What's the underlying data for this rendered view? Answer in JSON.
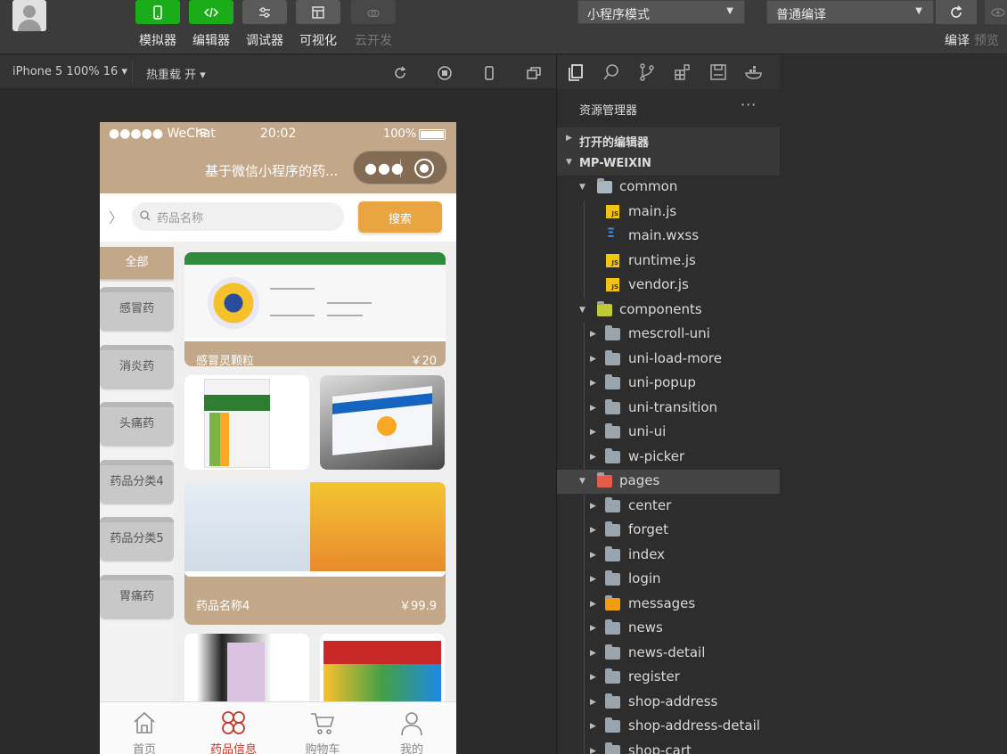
{
  "toolbar": {
    "buttons": [
      {
        "label": "模拟器"
      },
      {
        "label": "编辑器"
      },
      {
        "label": "调试器"
      },
      {
        "label": "可视化"
      },
      {
        "label": "云开发"
      }
    ],
    "mode_select": "小程序模式",
    "compile_select": "普通编译",
    "compile_label": "编译",
    "preview_label": "预览"
  },
  "simbar": {
    "device": "iPhone 5 100% 16 ▾",
    "hot_reload": "热重载 开 ▾"
  },
  "phone": {
    "carrier": "●●●●● WeChat",
    "time": "20:02",
    "battery": "100%",
    "nav_title": "基于微信小程序的药...",
    "search_placeholder": "药品名称",
    "search_button": "搜索",
    "categories": [
      "全部",
      "感冒药",
      "消炎药",
      "头痛药",
      "药品分类4",
      "药品分类5",
      "胃痛药"
    ],
    "products": [
      {
        "name": "感冒灵颗粒",
        "price": "￥20"
      },
      {
        "name": "药品名称4",
        "price": "￥99.9"
      }
    ],
    "tabs": [
      {
        "label": "首页"
      },
      {
        "label": "药品信息"
      },
      {
        "label": "购物车"
      },
      {
        "label": "我的"
      }
    ]
  },
  "explorer": {
    "title": "资源管理器",
    "open_editors": "打开的编辑器",
    "project": "MP-WEIXIN",
    "tree": [
      {
        "label": "common"
      },
      {
        "label": "main.js"
      },
      {
        "label": "main.wxss"
      },
      {
        "label": "runtime.js"
      },
      {
        "label": "vendor.js"
      },
      {
        "label": "components"
      },
      {
        "label": "mescroll-uni"
      },
      {
        "label": "uni-load-more"
      },
      {
        "label": "uni-popup"
      },
      {
        "label": "uni-transition"
      },
      {
        "label": "uni-ui"
      },
      {
        "label": "w-picker"
      },
      {
        "label": "pages"
      },
      {
        "label": "center"
      },
      {
        "label": "forget"
      },
      {
        "label": "index"
      },
      {
        "label": "login"
      },
      {
        "label": "messages"
      },
      {
        "label": "news"
      },
      {
        "label": "news-detail"
      },
      {
        "label": "register"
      },
      {
        "label": "shop-address"
      },
      {
        "label": "shop-address-detail"
      },
      {
        "label": "shop-cart"
      }
    ]
  },
  "colors": {
    "accent_green": "#1aad19",
    "nav_tan": "#c3a789",
    "search_orange": "#e9a541",
    "tab_active_red": "#c0392b"
  }
}
